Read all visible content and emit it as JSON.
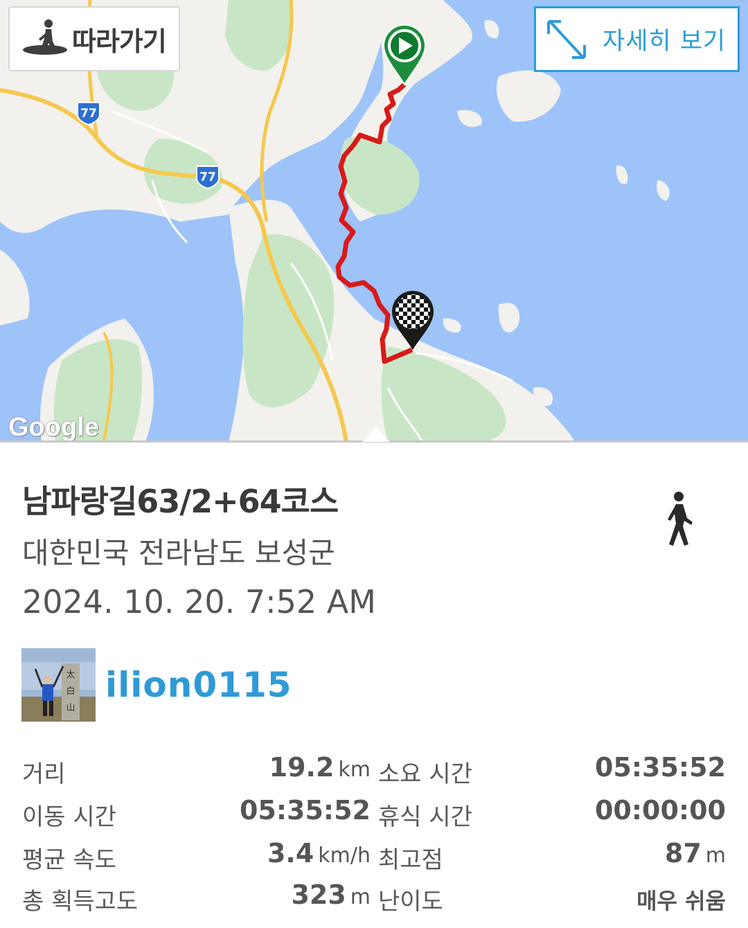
{
  "map": {
    "follow_button": {
      "label": "따라가기",
      "icon": "hiker-icon"
    },
    "detail_button": {
      "label": "자세히 보기",
      "icon": "expand-arrows-icon"
    },
    "road_shields": [
      "77",
      "77"
    ],
    "google_logo": "Google",
    "colors": {
      "water": "#9dc3f9",
      "land": "#f3f1ed",
      "green": "#c8e6c6",
      "route": "#d81a1a",
      "road": "#f5c84c",
      "accent": "#2d9cd8"
    }
  },
  "track": {
    "title": "남파랑길63/2+64코스",
    "region": "대한민국 전라남도 보성군",
    "datetime": "2024. 10. 20. 7:52 AM",
    "activity_icon": "walking-icon"
  },
  "user": {
    "name": "ilion0115",
    "avatar_text": "太白山"
  },
  "stats": [
    {
      "label": "거리",
      "value": "19.2",
      "unit": "km"
    },
    {
      "label": "소요 시간",
      "value": "05:35:52",
      "unit": ""
    },
    {
      "label": "이동 시간",
      "value": "05:35:52",
      "unit": ""
    },
    {
      "label": "휴식 시간",
      "value": "00:00:00",
      "unit": ""
    },
    {
      "label": "평균 속도",
      "value": "3.4",
      "unit": "km/h"
    },
    {
      "label": "최고점",
      "value": "87",
      "unit": "m"
    },
    {
      "label": "총 획득고도",
      "value": "323",
      "unit": "m"
    },
    {
      "label": "난이도",
      "value": "매우 쉬움",
      "unit": ""
    }
  ]
}
